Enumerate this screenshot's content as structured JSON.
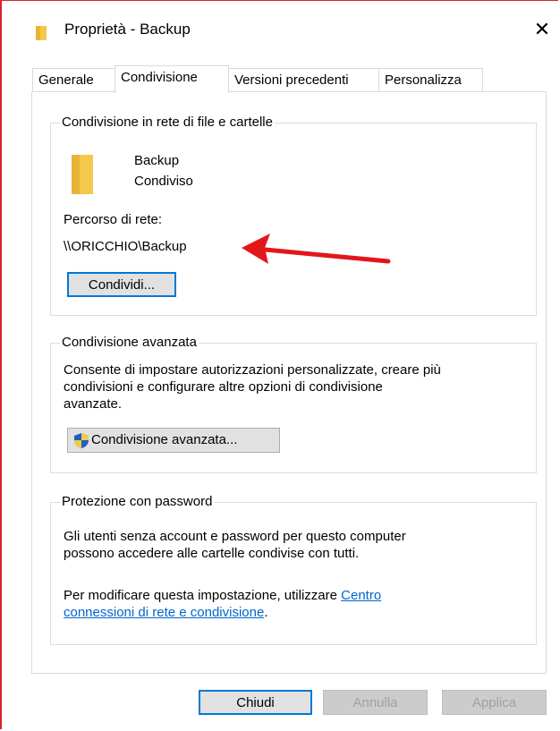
{
  "window": {
    "title": "Proprietà - Backup",
    "close_glyph": "✕"
  },
  "tabs": [
    {
      "label": "Generale",
      "active": false
    },
    {
      "label": "Condivisione",
      "active": true
    },
    {
      "label": "Versioni precedenti",
      "active": false
    },
    {
      "label": "Personalizza",
      "active": false
    }
  ],
  "network_sharing": {
    "group_title": "Condivisione in rete di file e cartelle",
    "folder_name": "Backup",
    "status": "Condiviso",
    "path_label": "Percorso di rete:",
    "path_value": "\\\\ORICCHIO\\Backup",
    "share_button": "Condividi..."
  },
  "advanced_sharing": {
    "group_title": "Condivisione avanzata",
    "description_line1": "Consente di impostare autorizzazioni personalizzate, creare più",
    "description_line2": "condivisioni e configurare altre opzioni di condivisione",
    "description_line3": "avanzate.",
    "button": "Condivisione avanzata..."
  },
  "password_protection": {
    "group_title": "Protezione con password",
    "text_line1": "Gli utenti senza account e password per questo computer",
    "text_line2": "possono accedere alle cartelle condivise con tutti.",
    "change_prefix": "Per modificare questa impostazione, utilizzare ",
    "link_part1": "Centro",
    "link_part2": "connessioni di rete e condivisione",
    "change_suffix": "."
  },
  "footer": {
    "close_button": "Chiudi",
    "cancel_button": "Annulla",
    "apply_button": "Applica"
  },
  "colors": {
    "annotation_arrow": "#e3161c",
    "folder_yellow": "#f4c84a",
    "link_blue": "#0066cc",
    "window_border": "#d9222a"
  },
  "icons": {
    "title": "folder-icon",
    "content": "folder-icon",
    "advanced_button": "uac-shield-icon",
    "annotation": "red-arrow-icon"
  }
}
